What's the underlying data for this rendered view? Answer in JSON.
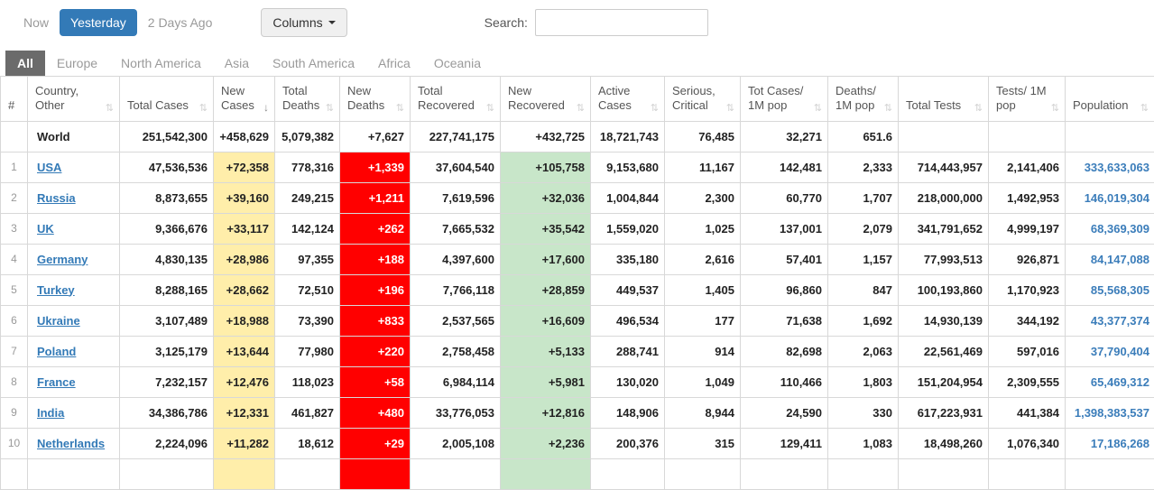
{
  "colors": {
    "accent_blue": "#337ab7",
    "link_blue": "#3b7dba",
    "new_cases_bg": "#ffeeaa",
    "new_deaths_bg": "#ff0000",
    "new_recovered_bg": "#c8e6c9",
    "world_row_bg": "#d6d6d6",
    "active_tab_bg": "#6b6b6b"
  },
  "toolbar": {
    "time_tabs": [
      {
        "label": "Now",
        "active": false
      },
      {
        "label": "Yesterday",
        "active": true
      },
      {
        "label": "2 Days Ago",
        "active": false
      }
    ],
    "columns_label": "Columns",
    "search_label": "Search:",
    "search_value": "",
    "search_placeholder": ""
  },
  "region_tabs": [
    {
      "label": "All",
      "active": true
    },
    {
      "label": "Europe",
      "active": false
    },
    {
      "label": "North America",
      "active": false
    },
    {
      "label": "Asia",
      "active": false
    },
    {
      "label": "South America",
      "active": false
    },
    {
      "label": "Africa",
      "active": false
    },
    {
      "label": "Oceania",
      "active": false
    }
  ],
  "table": {
    "headers": [
      {
        "label": "#",
        "sort": "none"
      },
      {
        "label": "Country, Other",
        "sort": "both"
      },
      {
        "label": "Total Cases",
        "sort": "both"
      },
      {
        "label": "New Cases",
        "sort": "desc"
      },
      {
        "label": "Total Deaths",
        "sort": "both"
      },
      {
        "label": "New Deaths",
        "sort": "both"
      },
      {
        "label": "Total Recovered",
        "sort": "both"
      },
      {
        "label": "New Recovered",
        "sort": "both"
      },
      {
        "label": "Active Cases",
        "sort": "both"
      },
      {
        "label": "Serious, Critical",
        "sort": "both"
      },
      {
        "label": "Tot Cases/ 1M pop",
        "sort": "both"
      },
      {
        "label": "Deaths/ 1M pop",
        "sort": "both"
      },
      {
        "label": "Total Tests",
        "sort": "both"
      },
      {
        "label": "Tests/ 1M pop",
        "sort": "both"
      },
      {
        "label": "Population",
        "sort": "both"
      }
    ],
    "world_row": [
      "",
      "World",
      "251,542,300",
      "+458,629",
      "5,079,382",
      "+7,627",
      "227,741,175",
      "+432,725",
      "18,721,743",
      "76,485",
      "32,271",
      "651.6",
      "",
      "",
      ""
    ],
    "rows": [
      [
        "1",
        "USA",
        "47,536,536",
        "+72,358",
        "778,316",
        "+1,339",
        "37,604,540",
        "+105,758",
        "9,153,680",
        "11,167",
        "142,481",
        "2,333",
        "714,443,957",
        "2,141,406",
        "333,633,063"
      ],
      [
        "2",
        "Russia",
        "8,873,655",
        "+39,160",
        "249,215",
        "+1,211",
        "7,619,596",
        "+32,036",
        "1,004,844",
        "2,300",
        "60,770",
        "1,707",
        "218,000,000",
        "1,492,953",
        "146,019,304"
      ],
      [
        "3",
        "UK",
        "9,366,676",
        "+33,117",
        "142,124",
        "+262",
        "7,665,532",
        "+35,542",
        "1,559,020",
        "1,025",
        "137,001",
        "2,079",
        "341,791,652",
        "4,999,197",
        "68,369,309"
      ],
      [
        "4",
        "Germany",
        "4,830,135",
        "+28,986",
        "97,355",
        "+188",
        "4,397,600",
        "+17,600",
        "335,180",
        "2,616",
        "57,401",
        "1,157",
        "77,993,513",
        "926,871",
        "84,147,088"
      ],
      [
        "5",
        "Turkey",
        "8,288,165",
        "+28,662",
        "72,510",
        "+196",
        "7,766,118",
        "+28,859",
        "449,537",
        "1,405",
        "96,860",
        "847",
        "100,193,860",
        "1,170,923",
        "85,568,305"
      ],
      [
        "6",
        "Ukraine",
        "3,107,489",
        "+18,988",
        "73,390",
        "+833",
        "2,537,565",
        "+16,609",
        "496,534",
        "177",
        "71,638",
        "1,692",
        "14,930,139",
        "344,192",
        "43,377,374"
      ],
      [
        "7",
        "Poland",
        "3,125,179",
        "+13,644",
        "77,980",
        "+220",
        "2,758,458",
        "+5,133",
        "288,741",
        "914",
        "82,698",
        "2,063",
        "22,561,469",
        "597,016",
        "37,790,404"
      ],
      [
        "8",
        "France",
        "7,232,157",
        "+12,476",
        "118,023",
        "+58",
        "6,984,114",
        "+5,981",
        "130,020",
        "1,049",
        "110,466",
        "1,803",
        "151,204,954",
        "2,309,555",
        "65,469,312"
      ],
      [
        "9",
        "India",
        "34,386,786",
        "+12,331",
        "461,827",
        "+480",
        "33,776,053",
        "+12,816",
        "148,906",
        "8,944",
        "24,590",
        "330",
        "617,223,931",
        "441,384",
        "1,398,383,537"
      ],
      [
        "10",
        "Netherlands",
        "2,224,096",
        "+11,282",
        "18,612",
        "+29",
        "2,005,108",
        "+2,236",
        "200,376",
        "315",
        "129,411",
        "1,083",
        "18,498,260",
        "1,076,340",
        "17,186,268"
      ]
    ],
    "has_partial_row": true
  }
}
